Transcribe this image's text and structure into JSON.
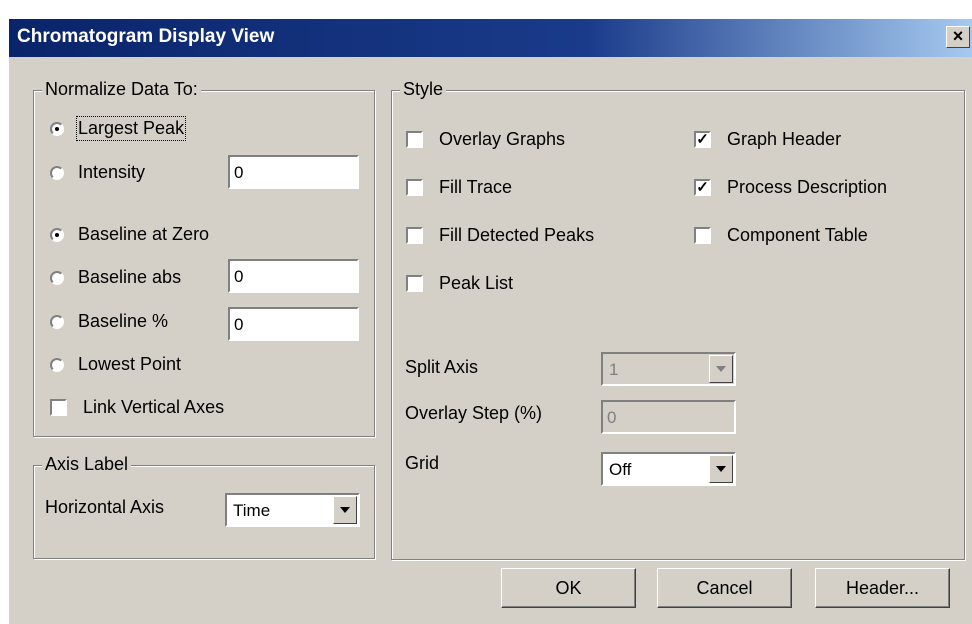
{
  "window": {
    "title": "Chromatogram Display View",
    "close_label": "×"
  },
  "normalize": {
    "legend": "Normalize Data To:",
    "largest_peak": "Largest Peak",
    "intensity": "Intensity",
    "intensity_value": "0",
    "baseline_zero": "Baseline at Zero",
    "baseline_abs": "Baseline abs",
    "baseline_abs_value": "0",
    "baseline_pct": "Baseline %",
    "baseline_pct_value": "0",
    "lowest_point": "Lowest Point",
    "link_axes": "Link Vertical Axes"
  },
  "axis_label": {
    "legend": "Axis Label",
    "horizontal_label": "Horizontal Axis",
    "horizontal_value": "Time"
  },
  "style": {
    "legend": "Style",
    "overlay_graphs": "Overlay Graphs",
    "fill_trace": "Fill Trace",
    "fill_detected_peaks": "Fill Detected Peaks",
    "peak_list": "Peak List",
    "graph_header": "Graph Header",
    "process_description": "Process Description",
    "component_table": "Component Table",
    "split_axis_label": "Split Axis",
    "split_axis_value": "1",
    "overlay_step_label": "Overlay Step (%)",
    "overlay_step_value": "0",
    "grid_label": "Grid",
    "grid_value": "Off"
  },
  "buttons": {
    "ok": "OK",
    "cancel": "Cancel",
    "header": "Header..."
  }
}
